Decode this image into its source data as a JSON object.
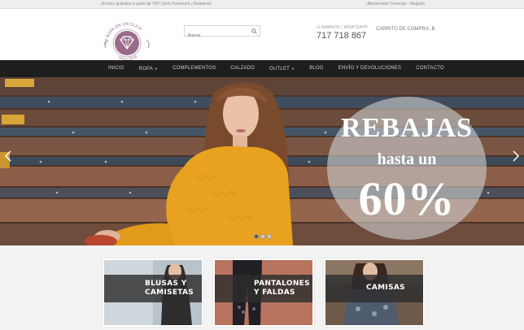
{
  "topbar": {
    "shipping_notice": "¡Envíos gratuitos a partir de 70€! (Sólo Península y Baleares)",
    "welcome": "¡Bienvenido!",
    "login": "Conectar",
    "register": "Registro"
  },
  "logo": {
    "text_top": "TU ROPA EN UN CLICK",
    "text_bottom": "since 2016"
  },
  "search": {
    "placeholder": "Buscar"
  },
  "contact": {
    "label": "LLÁMANOS / WHATSAPP",
    "phone": "717 718 867"
  },
  "cart": {
    "label": "CARRITO DE COMPRA:",
    "count": "0"
  },
  "nav": {
    "items": [
      {
        "label": "INICIO"
      },
      {
        "label": "ROPA",
        "dropdown": true
      },
      {
        "label": "COMPLEMENTOS"
      },
      {
        "label": "CALZADO"
      },
      {
        "label": "OUTLET",
        "dropdown": true
      },
      {
        "label": "BLOG"
      },
      {
        "label": "ENVÍO Y DEVOLUCIONES"
      },
      {
        "label": "CONTACTO"
      }
    ]
  },
  "hero": {
    "line1": "REBAJAS",
    "line2": "hasta un",
    "line3": "60%",
    "slides": 3,
    "active_slide": 1
  },
  "categories": [
    {
      "line1": "BLUSAS Y",
      "line2": "CAMISETAS"
    },
    {
      "line1": "PANTALONES",
      "line2": "Y FALDAS"
    },
    {
      "line1": "CAMISAS",
      "line2": ""
    }
  ],
  "colors": {
    "accent": "#9b6b8c",
    "nav_bg": "#1e1e1e",
    "sweater": "#e8a21f"
  }
}
